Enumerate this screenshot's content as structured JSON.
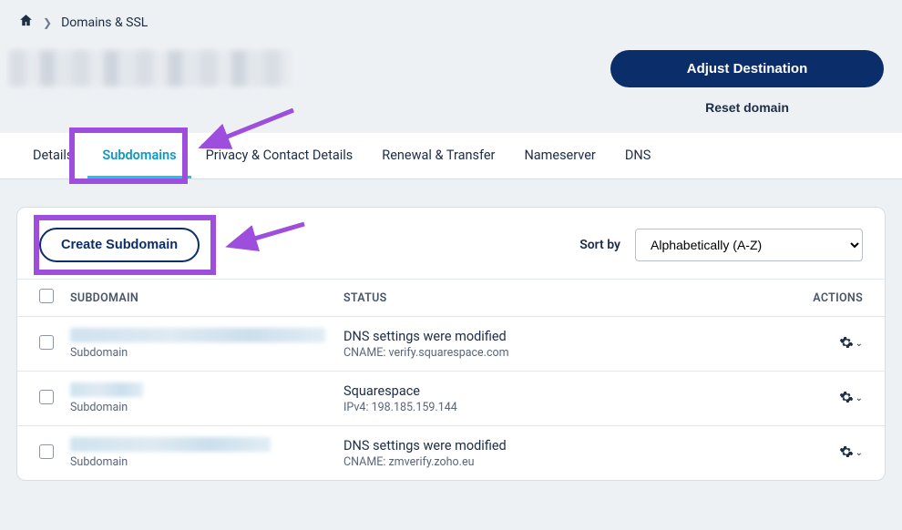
{
  "breadcrumb": {
    "page_title": "Domains & SSL"
  },
  "header": {
    "adjust_btn": "Adjust Destination",
    "reset_btn": "Reset domain"
  },
  "tabs": {
    "items": [
      {
        "label": "Details"
      },
      {
        "label": "Subdomains"
      },
      {
        "label": "Privacy & Contact Details"
      },
      {
        "label": "Renewal & Transfer"
      },
      {
        "label": "Nameserver"
      },
      {
        "label": "DNS"
      }
    ],
    "active_index": 1
  },
  "panel": {
    "create_btn": "Create Subdomain",
    "sort_label": "Sort by",
    "sort_option": "Alphabetically (A-Z)",
    "columns": {
      "sub": "SUBDOMAIN",
      "status": "STATUS",
      "actions": "ACTIONS"
    },
    "rows": [
      {
        "type_label": "Subdomain",
        "status_main": "DNS settings were modified",
        "status_sub": "CNAME: verify.squarespace.com",
        "blur_w": 280
      },
      {
        "type_label": "Subdomain",
        "status_main": "Squarespace",
        "status_sub": "IPv4: 198.185.159.144",
        "blur_w": 80
      },
      {
        "type_label": "Subdomain",
        "status_main": "DNS settings were modified",
        "status_sub": "CNAME: zmverify.zoho.eu",
        "blur_w": 220
      }
    ]
  },
  "icons": {
    "home": "home-icon",
    "gear": "gear-icon",
    "chev": "chevron-right-icon",
    "chev_down": "chevron-down-icon"
  }
}
